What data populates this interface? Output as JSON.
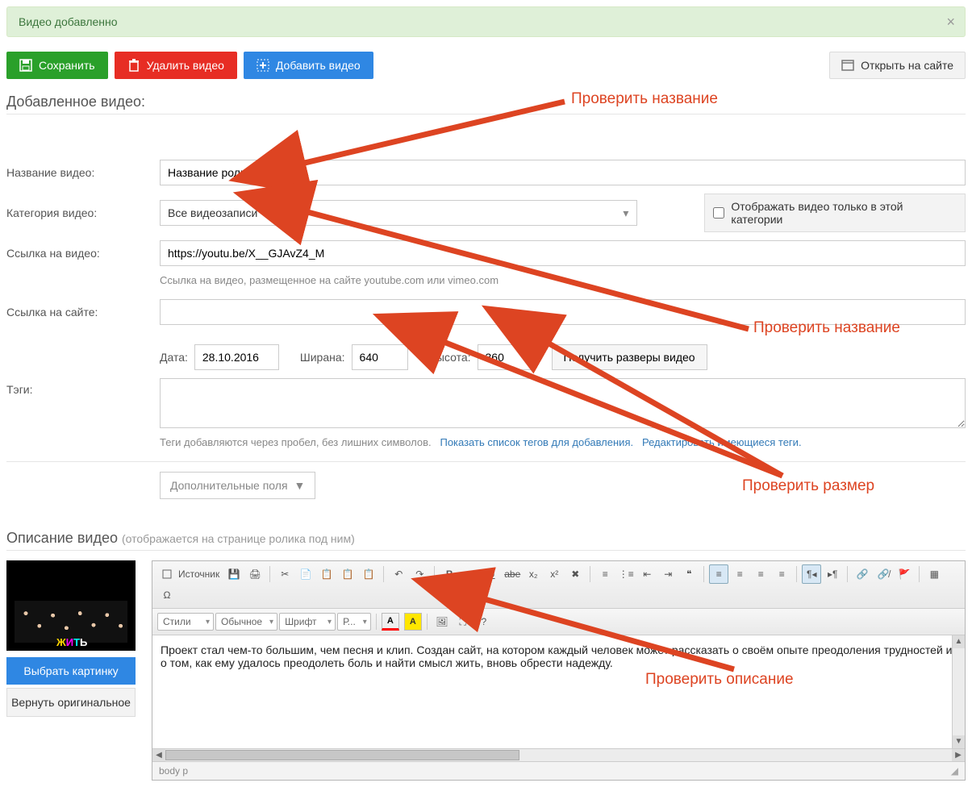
{
  "alert": {
    "text": "Видео добавленно",
    "close": "×"
  },
  "toolbar": {
    "save": "Сохранить",
    "delete": "Удалить видео",
    "add": "Добавить видео",
    "open": "Открыть на сайте"
  },
  "section1_title": "Добавленное видео:",
  "labels": {
    "title": "Название видео:",
    "category": "Категория видео:",
    "link": "Ссылка на видео:",
    "sitelink": "Ссылка на сайте:",
    "tags": "Тэги:",
    "date": "Дата:",
    "width": "Ширана:",
    "height": "Высота:"
  },
  "fields": {
    "title_value": "Название ролика",
    "category_value": "Все видеозаписи",
    "category_only": "Отображать видео только в этой категории",
    "link_value": "https://youtu.be/X__GJAvZ4_M",
    "link_help": "Ссылка на видео, размещенное на сайте youtube.com или vimeo.com",
    "sitelink_value": "",
    "date_value": "28.10.2016",
    "width_value": "640",
    "height_value": "360",
    "get_size": "Получить разверы видео",
    "tags_value": "",
    "tags_help_static": "Теги добавляются через пробел, без лишних символов.",
    "tags_link1": "Показать список тегов для добавления.",
    "tags_link2": "Редактировать имеющиеся теги.",
    "more_fields": "Дополнительные поля"
  },
  "section2_title": "Описание видео",
  "section2_sub": "(отображается на странице ролика под ним)",
  "thumb": {
    "choose": "Выбрать картинку",
    "restore": "Вернуть оригинальное",
    "logo_text": "ЖИТЬ"
  },
  "editor": {
    "source": "Источник",
    "styles": "Стили",
    "format": "Обычное",
    "font": "Шрифт",
    "size": "Р...",
    "body_text": "Проект стал чем-то большим, чем песня и клип. Создан сайт, на котором каждый человек может рассказать о своём опыте преодоления трудностей и о том, как ему удалось преодолеть боль и найти смысл жить, вновь обрести надежду.",
    "status": "body  p"
  },
  "annotations": {
    "a1": "Проверить название",
    "a2": "Проверить название",
    "a3": "Проверить размер",
    "a4": "Проверить описание"
  }
}
